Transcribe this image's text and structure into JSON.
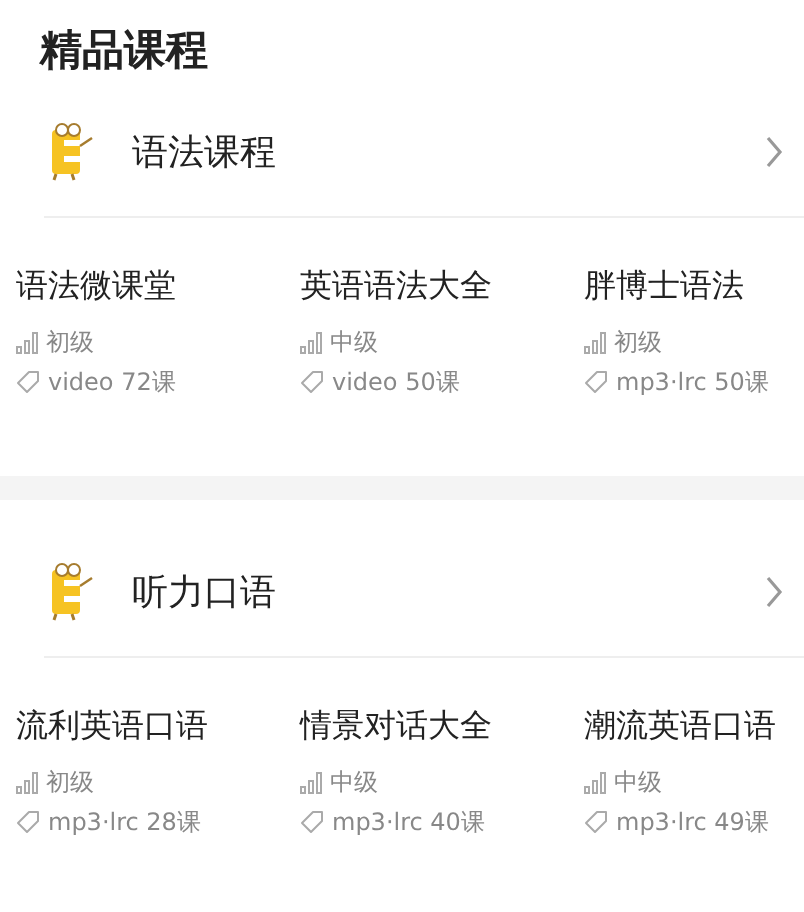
{
  "title": "精品课程",
  "sections": [
    {
      "name": "语法课程",
      "courses": [
        {
          "name": "语法微课堂",
          "level": "初级",
          "info": "video 72课"
        },
        {
          "name": "英语语法大全",
          "level": "中级",
          "info": "video 50课"
        },
        {
          "name": "胖博士语法",
          "level": "初级",
          "info": "mp3·lrc 50课"
        }
      ]
    },
    {
      "name": "听力口语",
      "courses": [
        {
          "name": "流利英语口语",
          "level": "初级",
          "info": "mp3·lrc 28课"
        },
        {
          "name": "情景对话大全",
          "level": "中级",
          "info": "mp3·lrc 40课"
        },
        {
          "name": "潮流英语口语",
          "level": "中级",
          "info": "mp3·lrc 49课"
        }
      ]
    }
  ]
}
